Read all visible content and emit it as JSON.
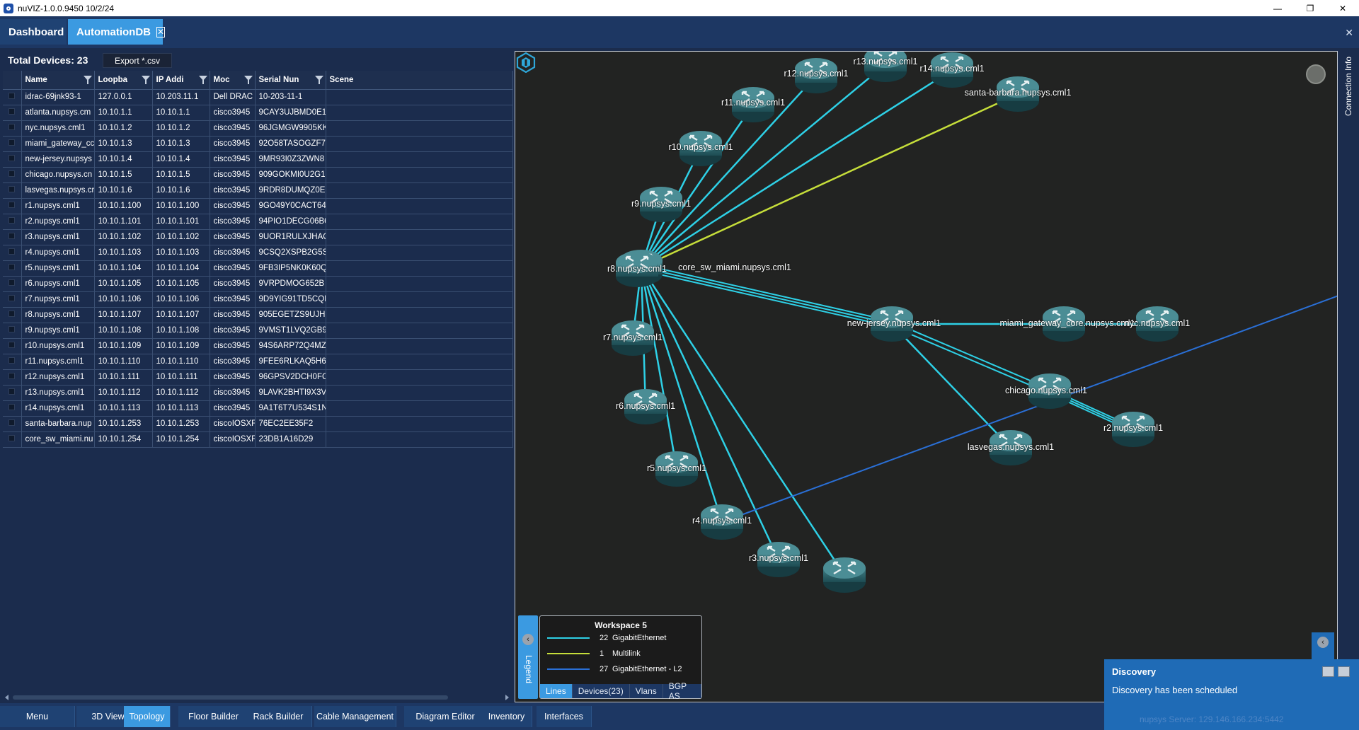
{
  "window": {
    "title": "nuVIZ-1.0.0.9450 10/2/24",
    "minimize": "—",
    "maximize": "❐",
    "close": "✕"
  },
  "tabs": {
    "dashboard": "Dashboard",
    "automation": "AutomationDB",
    "close_glyph": "✕",
    "close_all": "✕"
  },
  "grid": {
    "total_label": "Total Devices:",
    "total_count": "23",
    "export_label": "Export *.csv",
    "columns": [
      "Name",
      "Loopba",
      "IP Addi",
      "Moc",
      "Serial Nun",
      "Scene"
    ],
    "rows": [
      [
        "idrac-69jnk93-1",
        "127.0.0.1",
        "10.203.11.1",
        "Dell DRAC",
        "10-203-11-1"
      ],
      [
        "atlanta.nupsys.cm",
        "10.10.1.1",
        "10.10.1.1",
        "cisco3945",
        "9CAY3UJBMD0E1"
      ],
      [
        "nyc.nupsys.cml1",
        "10.10.1.2",
        "10.10.1.2",
        "cisco3945",
        "96JGMGW9905KK"
      ],
      [
        "miami_gateway_cc",
        "10.10.1.3",
        "10.10.1.3",
        "cisco3945",
        "92O58TASOGZF7I"
      ],
      [
        "new-jersey.nupsys",
        "10.10.1.4",
        "10.10.1.4",
        "cisco3945",
        "9MR93I0Z3ZWN8"
      ],
      [
        "chicago.nupsys.cn",
        "10.10.1.5",
        "10.10.1.5",
        "cisco3945",
        "909GOKMI0U2G1"
      ],
      [
        "lasvegas.nupsys.cr",
        "10.10.1.6",
        "10.10.1.6",
        "cisco3945",
        "9RDR8DUMQZ0E"
      ],
      [
        "r1.nupsys.cml1",
        "10.10.1.100",
        "10.10.1.100",
        "cisco3945",
        "9GO49Y0CACT64"
      ],
      [
        "r2.nupsys.cml1",
        "10.10.1.101",
        "10.10.1.101",
        "cisco3945",
        "94PIO1DECG06B6"
      ],
      [
        "r3.nupsys.cml1",
        "10.10.1.102",
        "10.10.1.102",
        "cisco3945",
        "9UOR1RULXJHAC"
      ],
      [
        "r4.nupsys.cml1",
        "10.10.1.103",
        "10.10.1.103",
        "cisco3945",
        "9CSQ2XSPB2G5SI"
      ],
      [
        "r5.nupsys.cml1",
        "10.10.1.104",
        "10.10.1.104",
        "cisco3945",
        "9FB3IP5NK0K60Q"
      ],
      [
        "r6.nupsys.cml1",
        "10.10.1.105",
        "10.10.1.105",
        "cisco3945",
        "9VRPDMOG652B"
      ],
      [
        "r7.nupsys.cml1",
        "10.10.1.106",
        "10.10.1.106",
        "cisco3945",
        "9D9YIG91TD5CQI"
      ],
      [
        "r8.nupsys.cml1",
        "10.10.1.107",
        "10.10.1.107",
        "cisco3945",
        "905EGETZS9UJHU"
      ],
      [
        "r9.nupsys.cml1",
        "10.10.1.108",
        "10.10.1.108",
        "cisco3945",
        "9VMST1LVQ2GB9"
      ],
      [
        "r10.nupsys.cml1",
        "10.10.1.109",
        "10.10.1.109",
        "cisco3945",
        "94S6ARP72Q4MZ"
      ],
      [
        "r11.nupsys.cml1",
        "10.10.1.110",
        "10.10.1.110",
        "cisco3945",
        "9FEE6RLKAQ5H6"
      ],
      [
        "r12.nupsys.cml1",
        "10.10.1.111",
        "10.10.1.111",
        "cisco3945",
        "96GPSV2DCH0FC"
      ],
      [
        "r13.nupsys.cml1",
        "10.10.1.112",
        "10.10.1.112",
        "cisco3945",
        "9LAVK2BHTI9X3V"
      ],
      [
        "r14.nupsys.cml1",
        "10.10.1.113",
        "10.10.1.113",
        "cisco3945",
        "9A1T6T7U534S1N"
      ],
      [
        "santa-barbara.nup",
        "10.10.1.253",
        "10.10.1.253",
        "ciscoIOSXF",
        "76EC2EE35F2"
      ],
      [
        "core_sw_miami.nu",
        "10.10.1.254",
        "10.10.1.254",
        "ciscoIOSXF",
        "23DB1A16D29"
      ]
    ]
  },
  "topology": {
    "nodes": [
      {
        "id": "core",
        "label": "core_sw_miami.nupsys.cml1"
      },
      {
        "id": "r13",
        "label": "r13.nupsys.cml1"
      },
      {
        "id": "r12",
        "label": "r12.nupsys.cml1"
      },
      {
        "id": "r14",
        "label": "r14.nupsys.cml1"
      },
      {
        "id": "sb",
        "label": "santa-barbara.nupsys.cml1"
      },
      {
        "id": "r11",
        "label": "r11.nupsys.cml1"
      },
      {
        "id": "r10",
        "label": "r10.nupsys.cml1"
      },
      {
        "id": "r9",
        "label": "r9.nupsys.cml1"
      },
      {
        "id": "r8",
        "label": "r8.nupsys.cml1"
      },
      {
        "id": "r7",
        "label": "r7.nupsys.cml1"
      },
      {
        "id": "r6",
        "label": "r6.nupsys.cml1"
      },
      {
        "id": "r5",
        "label": "r5.nupsys.cml1"
      },
      {
        "id": "r4",
        "label": "r4.nupsys.cml1"
      },
      {
        "id": "r3",
        "label": "r3.nupsys.cml1"
      },
      {
        "id": "nj",
        "label": "new-jersey.nupsys.cml1"
      },
      {
        "id": "mg",
        "label": "miami_gateway_core.nupsys.cml1"
      },
      {
        "id": "nyc",
        "label": "nyc.nupsys.cml1"
      },
      {
        "id": "chi",
        "label": "chicago.nupsys.cml1"
      },
      {
        "id": "r2",
        "label": "r2.nupsys.cml1"
      },
      {
        "id": "lv",
        "label": "lasvegas.nupsys.cml1"
      },
      {
        "id": "r1",
        "label": ""
      }
    ],
    "colors": {
      "gig": "#2ed0e6",
      "multi": "#c6de3a",
      "l2": "#2a6fd6",
      "bg": "#222322"
    }
  },
  "legend": {
    "tab_label": "Legend",
    "title": "Workspace 5",
    "rows": [
      {
        "count": "22",
        "label": "GigabitEthernet"
      },
      {
        "count": "1",
        "label": "Multilink"
      },
      {
        "count": "27",
        "label": "GigabitEthernet - L2"
      }
    ],
    "tabs": [
      "Lines",
      "Devices(23)",
      "Vlans",
      "BGP AS"
    ]
  },
  "side": {
    "connection_info": "Connection Info"
  },
  "bottom": {
    "tabs": [
      "Menu",
      "3D View",
      "Topology",
      "Floor Builder",
      "Rack Builder",
      "Cable Management",
      "Diagram Editor",
      "Inventory",
      "Interfaces"
    ]
  },
  "toast": {
    "title": "Discovery",
    "message": "Discovery has been scheduled",
    "status": "nupsys   Server: 129.146.166.234:5442"
  }
}
